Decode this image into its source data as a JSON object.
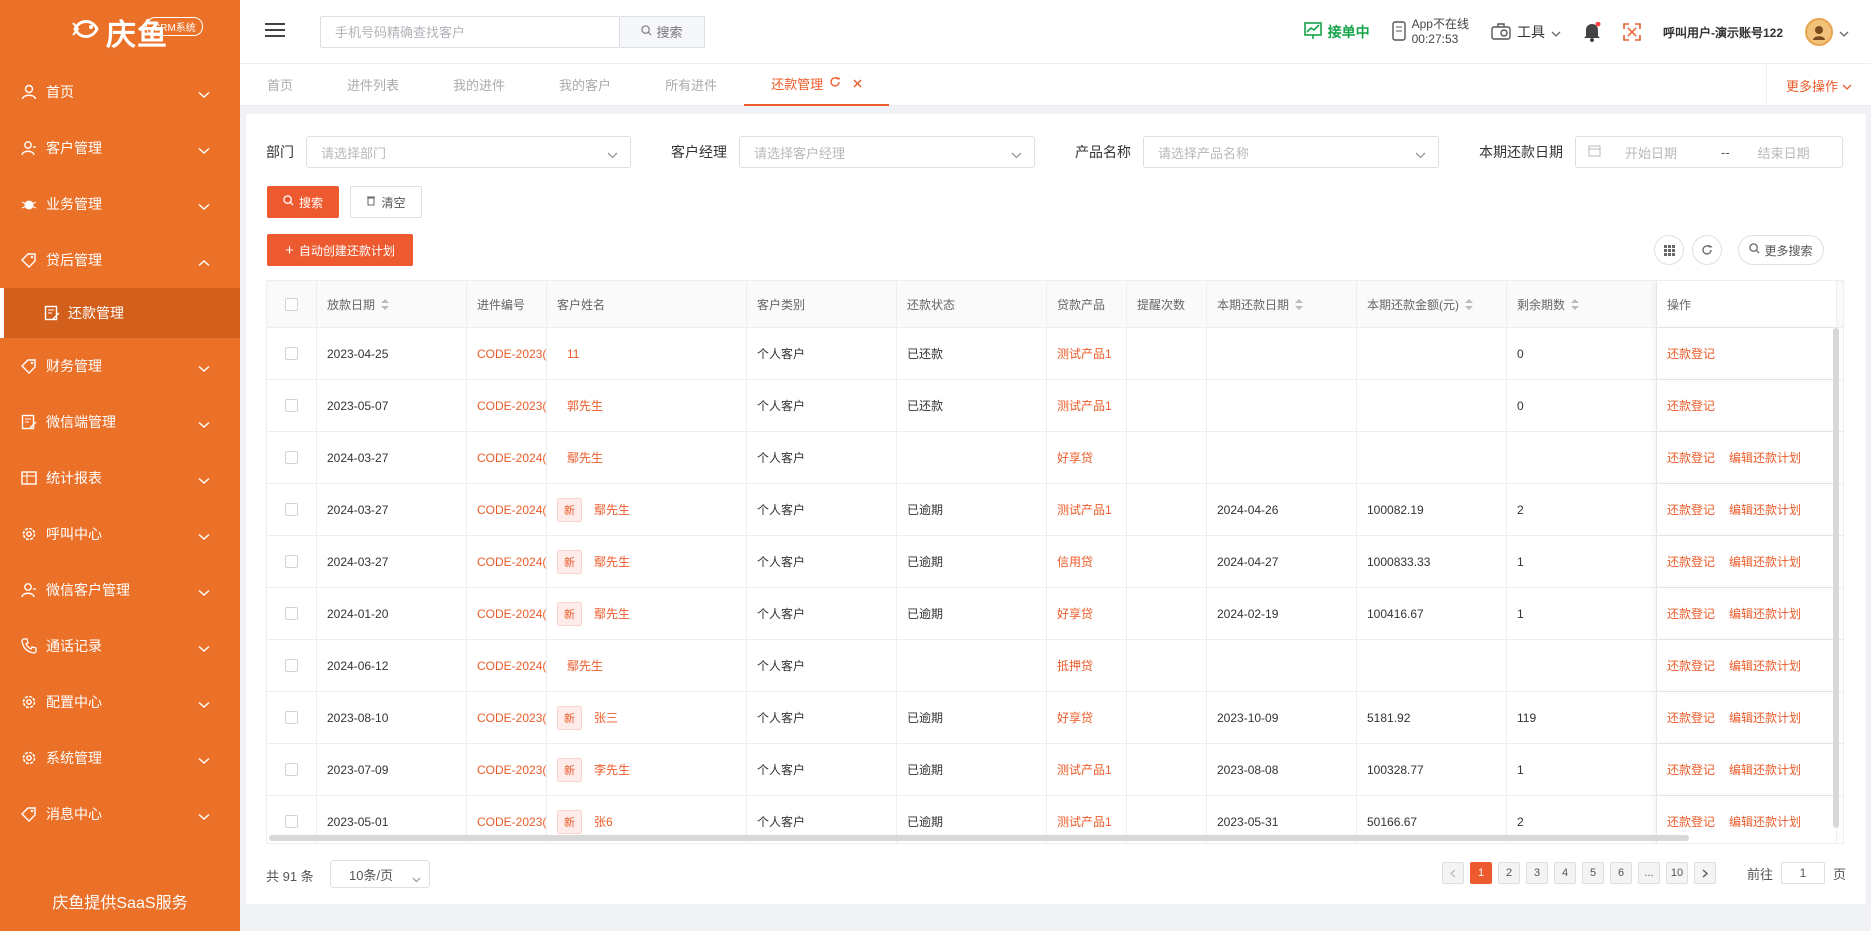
{
  "brand": {
    "name": "庆鱼",
    "badge": "CRM系统",
    "footer": "庆鱼提供SaaS服务",
    "accent": "#ec7128",
    "primary": "#ee5a2f"
  },
  "sidebar": {
    "items": [
      {
        "label": "首页",
        "icon": "user-icon"
      },
      {
        "label": "客户管理",
        "icon": "customer-icon"
      },
      {
        "label": "业务管理",
        "icon": "gear-bug-icon"
      },
      {
        "label": "贷后管理",
        "icon": "tag-icon",
        "expanded": true
      },
      {
        "label": "财务管理",
        "icon": "tag-icon"
      },
      {
        "label": "微信端管理",
        "icon": "edit-icon"
      },
      {
        "label": "统计报表",
        "icon": "table-icon"
      },
      {
        "label": "呼叫中心",
        "icon": "gear-icon"
      },
      {
        "label": "微信客户管理",
        "icon": "customer-icon"
      },
      {
        "label": "通话记录",
        "icon": "phone-icon"
      },
      {
        "label": "配置中心",
        "icon": "gear-icon"
      },
      {
        "label": "系统管理",
        "icon": "gear-icon"
      },
      {
        "label": "消息中心",
        "icon": "tag-icon"
      }
    ],
    "sub_active": "还款管理"
  },
  "header": {
    "search_placeholder": "手机号码精确查找客户",
    "search_btn": "搜索",
    "order_status": "接单中",
    "app_status": "App不在线",
    "app_timer": "00:27:53",
    "tools": "工具",
    "user": "呼叫用户-演示账号122"
  },
  "tabs": [
    "首页",
    "进件列表",
    "我的进件",
    "我的客户",
    "所有进件",
    "还款管理"
  ],
  "more_ops": "更多操作",
  "filters": {
    "dept_label": "部门",
    "dept_placeholder": "请选择部门",
    "manager_label": "客户经理",
    "manager_placeholder": "请选择客户经理",
    "product_label": "产品名称",
    "product_placeholder": "请选择产品名称",
    "date_label": "本期还款日期",
    "date_start": "开始日期",
    "date_sep": "--",
    "date_end": "结束日期"
  },
  "buttons": {
    "search": "搜索",
    "clear": "清空",
    "auto_create": "自动创建还款计划",
    "more_search": "更多搜索"
  },
  "table": {
    "headers": [
      "放款日期",
      "进件编号",
      "客户姓名",
      "客户类别",
      "还款状态",
      "贷款产品",
      "提醒次数",
      "本期还款日期",
      "本期还款金额(元)",
      "剩余期数",
      "操作"
    ],
    "new_tag": "新",
    "op_register": "还款登记",
    "op_edit": "编辑还款计划",
    "rows": [
      {
        "date": "2023-04-25",
        "code": "CODE-2023(",
        "isNew": false,
        "name": "11",
        "type": "个人客户",
        "status": "已还款",
        "product": "测试产品1",
        "remind": "",
        "due": "",
        "amount": "",
        "left": "0",
        "editable": false
      },
      {
        "date": "2023-05-07",
        "code": "CODE-2023(",
        "isNew": false,
        "name": "郭先生",
        "type": "个人客户",
        "status": "已还款",
        "product": "测试产品1",
        "remind": "",
        "due": "",
        "amount": "",
        "left": "0",
        "editable": false
      },
      {
        "date": "2024-03-27",
        "code": "CODE-2024(",
        "isNew": false,
        "name": "鄢先生",
        "type": "个人客户",
        "status": "",
        "product": "好享贷",
        "remind": "",
        "due": "",
        "amount": "",
        "left": "",
        "editable": true
      },
      {
        "date": "2024-03-27",
        "code": "CODE-2024(",
        "isNew": true,
        "name": "鄢先生",
        "type": "个人客户",
        "status": "已逾期",
        "product": "测试产品1",
        "remind": "",
        "due": "2024-04-26",
        "amount": "100082.19",
        "left": "2",
        "editable": true
      },
      {
        "date": "2024-03-27",
        "code": "CODE-2024(",
        "isNew": true,
        "name": "鄢先生",
        "type": "个人客户",
        "status": "已逾期",
        "product": "信用贷",
        "remind": "",
        "due": "2024-04-27",
        "amount": "1000833.33",
        "left": "1",
        "editable": true
      },
      {
        "date": "2024-01-20",
        "code": "CODE-2024(",
        "isNew": true,
        "name": "鄢先生",
        "type": "个人客户",
        "status": "已逾期",
        "product": "好享贷",
        "remind": "",
        "due": "2024-02-19",
        "amount": "100416.67",
        "left": "1",
        "editable": true
      },
      {
        "date": "2024-06-12",
        "code": "CODE-2024(",
        "isNew": false,
        "name": "鄢先生",
        "type": "个人客户",
        "status": "",
        "product": "抵押贷",
        "remind": "",
        "due": "",
        "amount": "",
        "left": "",
        "editable": true
      },
      {
        "date": "2023-08-10",
        "code": "CODE-2023(",
        "isNew": true,
        "name": "张三",
        "type": "个人客户",
        "status": "已逾期",
        "product": "好享贷",
        "remind": "",
        "due": "2023-10-09",
        "amount": "5181.92",
        "left": "119",
        "editable": true
      },
      {
        "date": "2023-07-09",
        "code": "CODE-2023(",
        "isNew": true,
        "name": "李先生",
        "type": "个人客户",
        "status": "已逾期",
        "product": "测试产品1",
        "remind": "",
        "due": "2023-08-08",
        "amount": "100328.77",
        "left": "1",
        "editable": true
      },
      {
        "date": "2023-05-01",
        "code": "CODE-2023(",
        "isNew": true,
        "name": "张6",
        "type": "个人客户",
        "status": "已逾期",
        "product": "测试产品1",
        "remind": "",
        "due": "2023-05-31",
        "amount": "50166.67",
        "left": "2",
        "editable": true
      }
    ]
  },
  "pagination": {
    "total": "共 91 条",
    "page_size": "10条/页",
    "pages": [
      "1",
      "2",
      "3",
      "4",
      "5",
      "6",
      "...",
      "10"
    ],
    "current": "1",
    "goto_label": "前往",
    "goto_value": "1",
    "goto_suffix": "页"
  }
}
